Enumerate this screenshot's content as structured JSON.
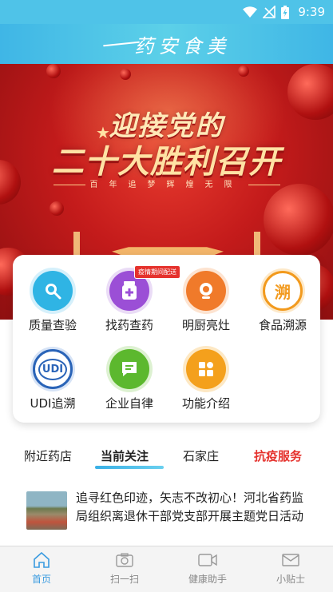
{
  "status_bar": {
    "time": "9:39",
    "icons": [
      "wifi-icon",
      "signal-off-icon",
      "battery-charging-icon"
    ]
  },
  "header": {
    "title": "药安食美"
  },
  "banner": {
    "line1": "迎接党的",
    "line2": "二十大胜利召开",
    "subtitle": "百年追梦辉煌无限"
  },
  "features": [
    {
      "label": "质量查验",
      "icon": "magnifier-icon",
      "color": "#2fb4e4"
    },
    {
      "label": "找药查药",
      "icon": "medicine-bottle-icon",
      "color": "#9b4fd6",
      "tag": "疫情期间配送"
    },
    {
      "label": "明厨亮灶",
      "icon": "camera-icon",
      "color": "#f07a2a"
    },
    {
      "label": "食品溯源",
      "icon": "trace-icon",
      "color": "#f29a1e",
      "glyph": "溯"
    },
    {
      "label": "UDI追溯",
      "icon": "udi-icon",
      "color": "#2a64b8",
      "glyph": "UDI"
    },
    {
      "label": "企业自律",
      "icon": "chat-icon",
      "color": "#5cb82e"
    },
    {
      "label": "功能介绍",
      "icon": "grid-icon",
      "color": "#f4a01c"
    }
  ],
  "tabs": [
    {
      "label": "附近药店"
    },
    {
      "label": "当前关注",
      "active": true
    },
    {
      "label": "石家庄"
    },
    {
      "label": "抗疫服务",
      "highlight": true
    }
  ],
  "news": [
    {
      "title": "追寻红色印迹，矢志不改初心！河北省药监局组织离退休干部党支部开展主题党日活动"
    }
  ],
  "bottom_nav": [
    {
      "label": "首页",
      "icon": "home-icon",
      "active": true
    },
    {
      "label": "扫一扫",
      "icon": "camera-icon"
    },
    {
      "label": "健康助手",
      "icon": "video-icon"
    },
    {
      "label": "小贴士",
      "icon": "mail-icon"
    }
  ]
}
